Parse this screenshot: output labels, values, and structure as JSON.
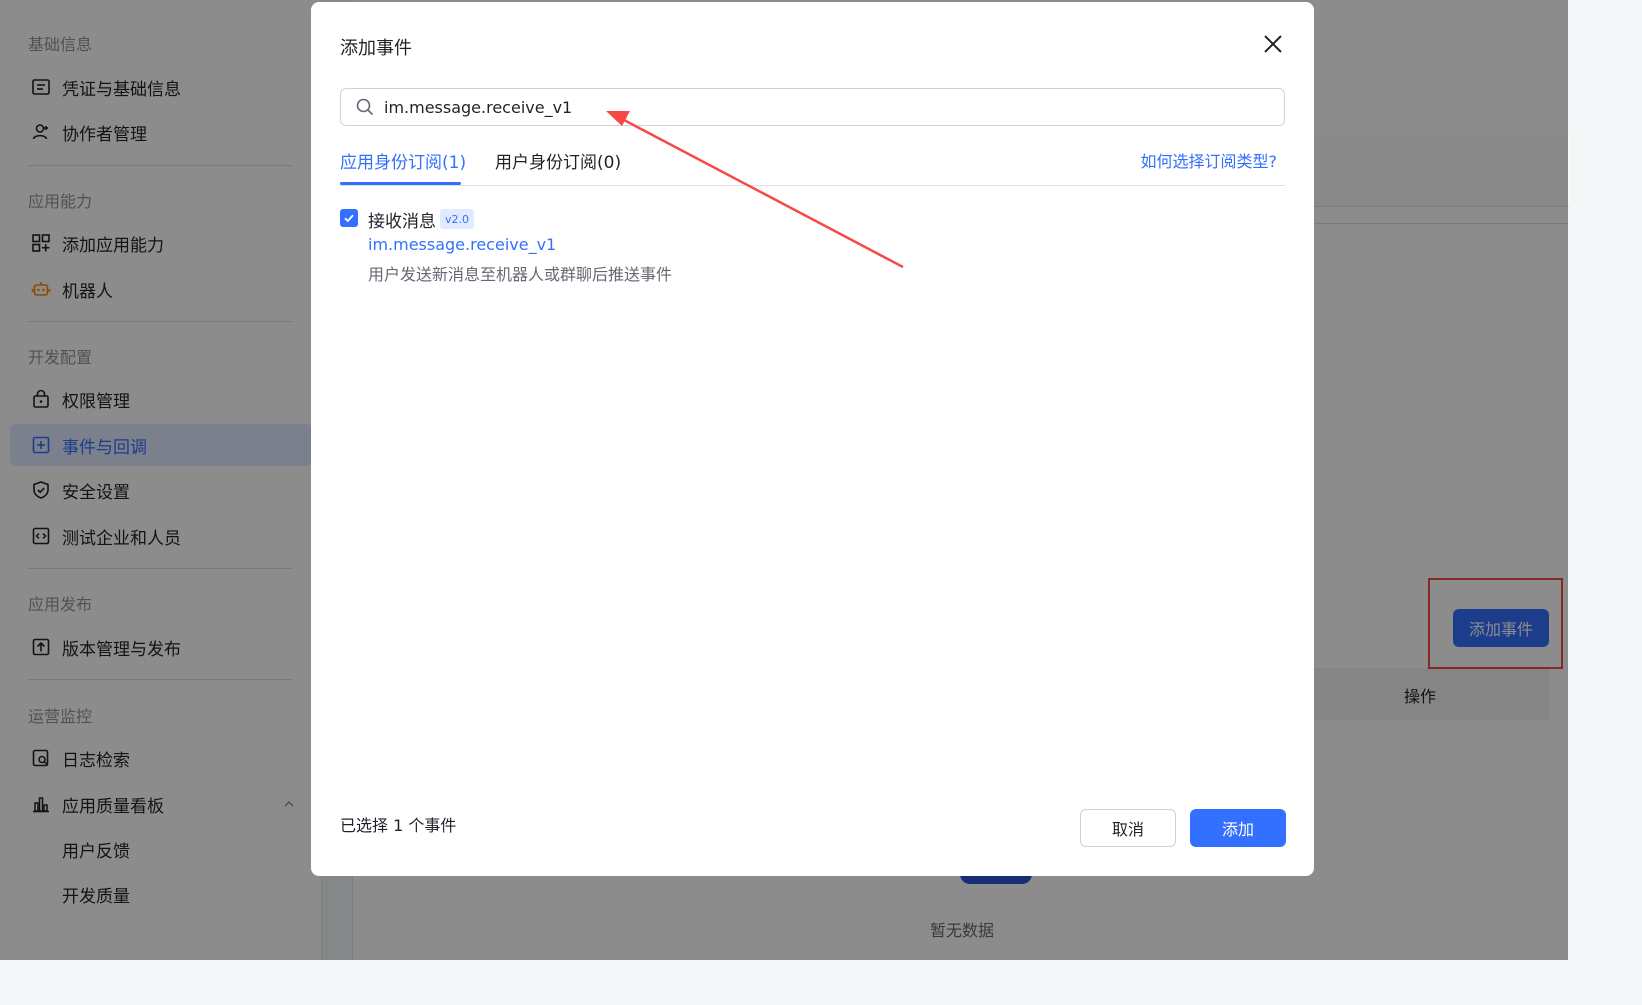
{
  "sidebar": {
    "groups": {
      "basic": "基础信息",
      "capability": "应用能力",
      "dev": "开发配置",
      "release": "应用发布",
      "ops": "运营监控"
    },
    "items": {
      "credentials": "凭证与基础信息",
      "collaborators": "协作者管理",
      "add_capability": "添加应用能力",
      "bot": "机器人",
      "permissions": "权限管理",
      "events": "事件与回调",
      "security": "安全设置",
      "test_enterprise": "测试企业和人员",
      "versions": "版本管理与发布",
      "log_search": "日志检索",
      "quality_board": "应用质量看板",
      "feedback": "用户反馈",
      "dev_quality": "开发质量"
    }
  },
  "background": {
    "add_event_button": "添加事件",
    "column_operation": "操作",
    "empty_text": "暂无数据"
  },
  "modal": {
    "title": "添加事件",
    "search_value": "im.message.receive_v1",
    "tabs": {
      "app_identity": "应用身份订阅(1)",
      "user_identity": "用户身份订阅(0)"
    },
    "help_link": "如何选择订阅类型?",
    "event": {
      "title": "接收消息",
      "version": "v2.0",
      "key": "im.message.receive_v1",
      "description": "用户发送新消息至机器人或群聊后推送事件",
      "checked": true
    },
    "selected_count": "已选择 1 个事件",
    "cancel_label": "取消",
    "add_label": "添加"
  },
  "colors": {
    "accent": "#3370ff",
    "annotation_red": "#f54a45"
  }
}
